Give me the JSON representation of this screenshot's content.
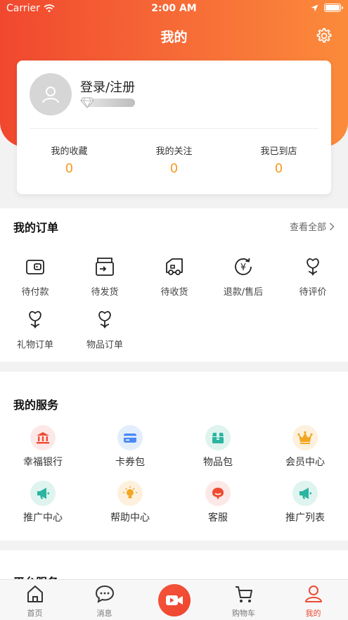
{
  "status_bar": {
    "carrier": "Carrier",
    "time": "2:00 AM"
  },
  "header": {
    "title": "我的"
  },
  "profile": {
    "login_label": "登录/注册",
    "stats": [
      {
        "label": "我的收藏",
        "value": "0"
      },
      {
        "label": "我的关注",
        "value": "0"
      },
      {
        "label": "我已到店",
        "value": "0"
      }
    ]
  },
  "orders": {
    "title": "我的订单",
    "view_all": "查看全部",
    "items": [
      {
        "label": "待付款",
        "icon": "wallet-icon"
      },
      {
        "label": "待发货",
        "icon": "box-out-icon"
      },
      {
        "label": "待收货",
        "icon": "truck-icon"
      },
      {
        "label": "退款/售后",
        "icon": "refund-icon"
      },
      {
        "label": "待评价",
        "icon": "flower-icon"
      },
      {
        "label": "礼物订单",
        "icon": "flower-icon"
      },
      {
        "label": "物品订单",
        "icon": "flower-icon"
      }
    ]
  },
  "services": {
    "title": "我的服务",
    "items": [
      {
        "label": "幸福银行",
        "icon": "bank-icon",
        "bg": "#fde8e8",
        "color": "#ee4b34"
      },
      {
        "label": "卡券包",
        "icon": "card-icon",
        "bg": "#e3eefc",
        "color": "#4a8af4"
      },
      {
        "label": "物品包",
        "icon": "package-icon",
        "bg": "#dff3ef",
        "color": "#2bb5a0"
      },
      {
        "label": "会员中心",
        "icon": "crown-icon",
        "bg": "#fdf1dd",
        "color": "#f2a623"
      },
      {
        "label": "推广中心",
        "icon": "megaphone-icon",
        "bg": "#dff3ef",
        "color": "#2bb5a0"
      },
      {
        "label": "帮助中心",
        "icon": "bulb-icon",
        "bg": "#fdf1dd",
        "color": "#f2a623"
      },
      {
        "label": "客服",
        "icon": "headset-icon",
        "bg": "#fde8e8",
        "color": "#ee4b34"
      },
      {
        "label": "推广列表",
        "icon": "megaphone-icon",
        "bg": "#dff3ef",
        "color": "#2bb5a0"
      }
    ]
  },
  "platform": {
    "title": "平台服务"
  },
  "tabbar": {
    "items": [
      {
        "label": "首页",
        "icon": "home-icon"
      },
      {
        "label": "消息",
        "icon": "message-icon"
      },
      {
        "label": "",
        "icon": "video-camera-icon"
      },
      {
        "label": "购物车",
        "icon": "cart-icon"
      },
      {
        "label": "我的",
        "icon": "user-icon"
      }
    ]
  },
  "colors": {
    "accent": "#ee4b34",
    "stat_number": "#f59b22"
  }
}
